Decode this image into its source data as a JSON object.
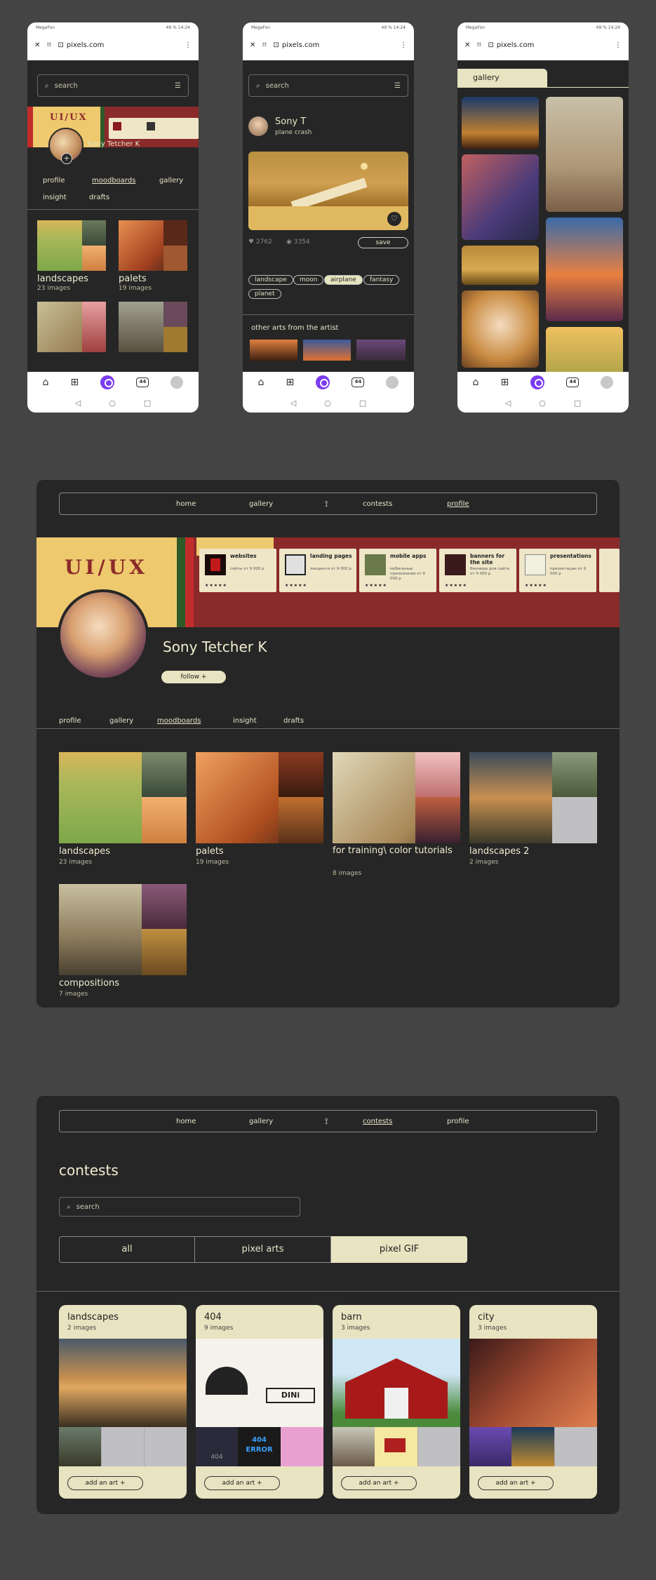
{
  "phone_common": {
    "carrier": "MegaFon",
    "battery": "49 %",
    "time": "14:24",
    "url": "pixels.com",
    "search_placeholder": "search"
  },
  "phone1": {
    "banner_text": "UI/UX",
    "profile_name": "Sony Tetcher K",
    "tabs": [
      "profile",
      "moodboards",
      "gallery",
      "insight",
      "drafts"
    ],
    "boards": [
      {
        "name": "landscapes",
        "count": "23 images"
      },
      {
        "name": "palets",
        "count": "19 images"
      }
    ]
  },
  "phone2": {
    "author": "Sony T",
    "title": "plane crash",
    "likes": "2762",
    "views": "3354",
    "save_label": "save",
    "tags": [
      "landscape",
      "moon",
      "airplane",
      "fantasy",
      "planet"
    ],
    "other_arts": "other arts from the artist"
  },
  "phone3": {
    "tab": "gallery"
  },
  "nav44": "44",
  "desktop1": {
    "nav": [
      "home",
      "gallery",
      "contests",
      "profile"
    ],
    "banner_text": "UI/UX",
    "profile_name": "Sony Tetcher K",
    "follow_label": "follow +",
    "categories": [
      {
        "title": "websites",
        "desc": "сайты от 9 000 р",
        "stars": "★★★★★"
      },
      {
        "title": "landing pages",
        "desc": "лендинги от 9 000 р",
        "stars": "★★★★★"
      },
      {
        "title": "mobile apps",
        "desc": "мобильные приложения от 9 000 р",
        "stars": "★★★★★"
      },
      {
        "title": "banners for the site",
        "desc": "баннеры для сайта от 9 000 р",
        "stars": "★★★★★"
      },
      {
        "title": "presentations",
        "desc": "презентации от 9 000 р",
        "stars": "★★★★★"
      }
    ],
    "tabs": [
      "profile",
      "gallery",
      "moodboards",
      "insight",
      "drafts"
    ],
    "boards": [
      {
        "name": "landscapes",
        "count": "23 images"
      },
      {
        "name": "palets",
        "count": "19 images"
      },
      {
        "name": "for training\\ color tutorials",
        "count": "8 images"
      },
      {
        "name": "landscapes 2",
        "count": "2 images"
      },
      {
        "name": "compositions",
        "count": "7 images"
      }
    ]
  },
  "desktop2": {
    "nav": [
      "home",
      "gallery",
      "contests",
      "profile"
    ],
    "title": "contests",
    "search_placeholder": "search",
    "filters": [
      "all",
      "pixel arts",
      "pixel GIF"
    ],
    "cards": [
      {
        "name": "landscapes",
        "count": "2 images",
        "button": "add an art +"
      },
      {
        "name": "404",
        "count": "9 images",
        "button": "add an art +"
      },
      {
        "name": "barn",
        "count": "3 images",
        "button": "add an art +"
      },
      {
        "name": "city",
        "count": "3 images",
        "button": "add an art +"
      }
    ],
    "art404": {
      "dini": "DINi",
      "error": "404 ERROR",
      "small": "404"
    }
  },
  "colors": {
    "bg": "#444444",
    "panel": "#262626",
    "cream": "#e8e3c0",
    "accent": "#7b3cf0",
    "banner_red": "#8b2a2a",
    "banner_yellow": "#eec96e"
  }
}
